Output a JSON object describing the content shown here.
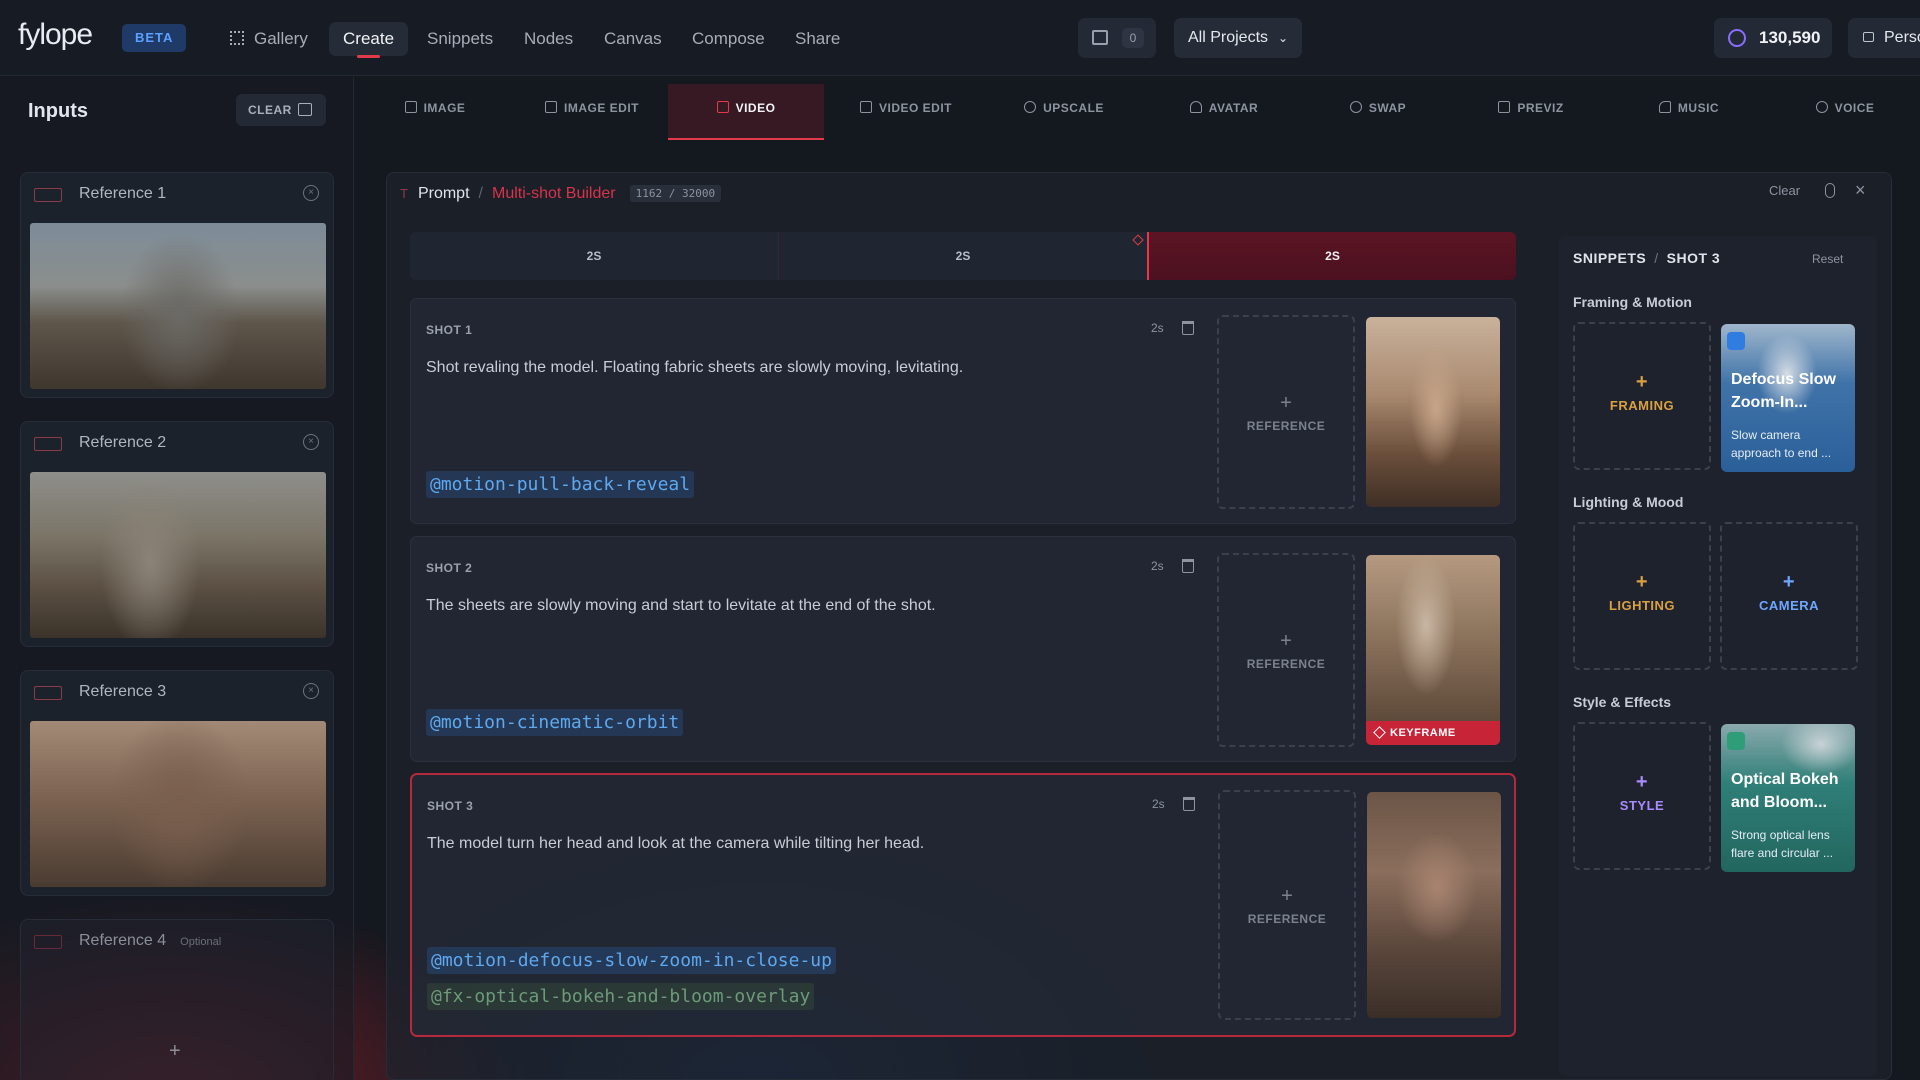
{
  "brand": {
    "logo": "fylope",
    "beta": "BETA"
  },
  "nav": {
    "items": [
      "Gallery",
      "Create",
      "Snippets",
      "Nodes",
      "Canvas",
      "Compose",
      "Share"
    ],
    "active": "Create"
  },
  "toolbar": {
    "archive_count": "0",
    "projects": "All Projects",
    "credits": "130,590",
    "persona": "Persona"
  },
  "inputs": {
    "title": "Inputs",
    "clear": "CLEAR",
    "references": [
      {
        "label": "Reference 1"
      },
      {
        "label": "Reference 2"
      },
      {
        "label": "Reference 3"
      },
      {
        "label": "Reference 4",
        "optional": "Optional"
      }
    ]
  },
  "tabs": [
    "IMAGE",
    "IMAGE EDIT",
    "VIDEO",
    "VIDEO EDIT",
    "UPSCALE",
    "AVATAR",
    "SWAP",
    "PREVIZ",
    "MUSIC",
    "VOICE"
  ],
  "active_tab": "VIDEO",
  "prompt": {
    "label": "Prompt",
    "separator": "/",
    "mode": "Multi-shot Builder",
    "count": "1162 / 32000",
    "clear": "Clear"
  },
  "timeline": {
    "segments": [
      "2S",
      "2S",
      "2S"
    ],
    "active_segment": 3
  },
  "shots": [
    {
      "label": "SHOT 1",
      "duration": "2s",
      "text": "Shot revaling the model. Floating fabric sheets are slowly moving, levitating.",
      "tags": [
        "@motion-pull-back-reveal"
      ],
      "reference": "REFERENCE",
      "keyframe": false
    },
    {
      "label": "SHOT 2",
      "duration": "2s",
      "text": "The sheets are slowly moving and start to levitate at the end of the shot.",
      "tags": [
        "@motion-cinematic-orbit"
      ],
      "reference": "REFERENCE",
      "keyframe": "KEYFRAME"
    },
    {
      "label": "SHOT 3",
      "duration": "2s",
      "text": "The model turn her head and look at the camera while tilting her head.",
      "tags": [
        "@motion-defocus-slow-zoom-in-close-up",
        "@fx-optical-bokeh-and-bloom-overlay"
      ],
      "reference": "REFERENCE",
      "keyframe": false
    }
  ],
  "snippets": {
    "title": "SNIPPETS",
    "separator": "/",
    "shot": "SHOT 3",
    "reset": "Reset",
    "sections": [
      {
        "title": "Framing & Motion",
        "add": "FRAMING",
        "card": {
          "title": "Defocus Slow Zoom-In...",
          "desc": "Slow camera approach to end ..."
        }
      },
      {
        "title": "Lighting & Mood",
        "add": "LIGHTING",
        "add2": "CAMERA"
      },
      {
        "title": "Style & Effects",
        "add": "STYLE",
        "card": {
          "title": "Optical Bokeh and Bloom...",
          "desc": "Strong optical lens flare and circular ..."
        }
      }
    ]
  },
  "colors": {
    "accent_red": "#e23a4a",
    "accent_blue": "#5aa0ff",
    "framing": "#d9a040",
    "camera": "#6fa6ff",
    "style": "#a98bff"
  }
}
